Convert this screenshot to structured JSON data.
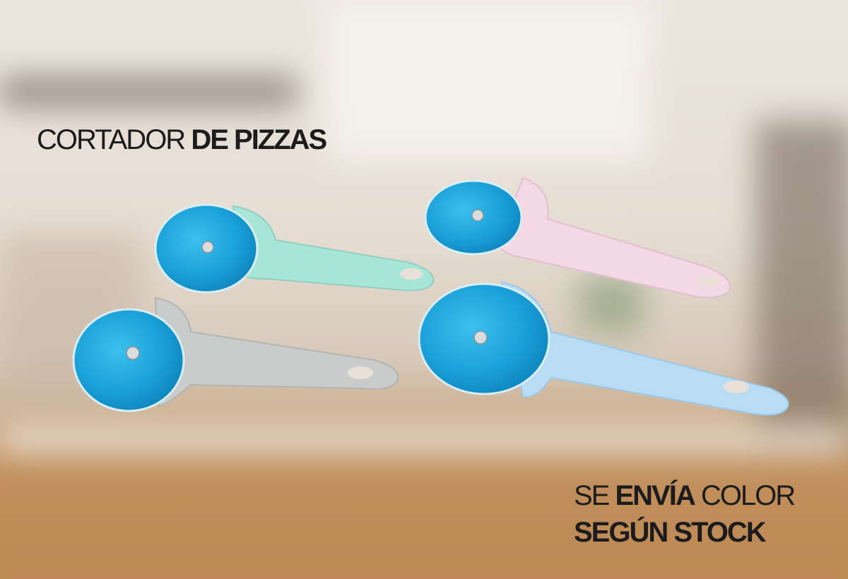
{
  "headline": {
    "part1": "CORTADOR",
    "part2": "DE PIZZAS"
  },
  "notice": {
    "part1": "SE",
    "part2": "ENVÍA",
    "part3": "COLOR",
    "line2": "SEGÚN STOCK"
  },
  "colors": {
    "mint": "#a8e6d8",
    "pink": "#f4d8e4",
    "gray": "#c9ccca",
    "blue": "#b8dcf4",
    "blade": "#1ea4dc"
  }
}
